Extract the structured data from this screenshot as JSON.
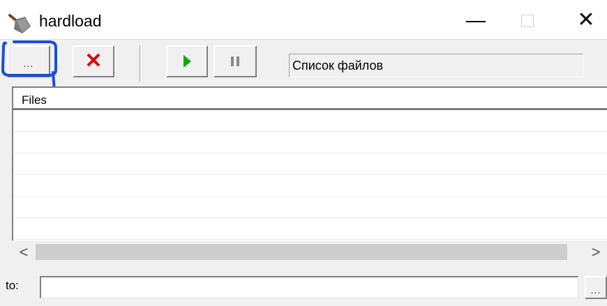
{
  "window": {
    "title": "hardload",
    "icon": "shovel-icon",
    "controls": {
      "minimize": "—",
      "maximize": "☐",
      "close": "✕"
    }
  },
  "toolbar": {
    "browse_label": "...",
    "delete_label": "✕",
    "play_icon": "play-icon",
    "pause_icon": "pause-icon",
    "status_text": "Список файлов"
  },
  "list": {
    "columns": [
      "Files"
    ],
    "rows": [
      "",
      "",
      "",
      "",
      "",
      ""
    ]
  },
  "scrollbar": {
    "left_arrow": "<",
    "right_arrow": ">"
  },
  "destination": {
    "label": "to:",
    "value": "",
    "browse_label": "..."
  },
  "colors": {
    "delete": "#e00000",
    "play": "#00b000",
    "annotation": "#1a4fd6"
  }
}
